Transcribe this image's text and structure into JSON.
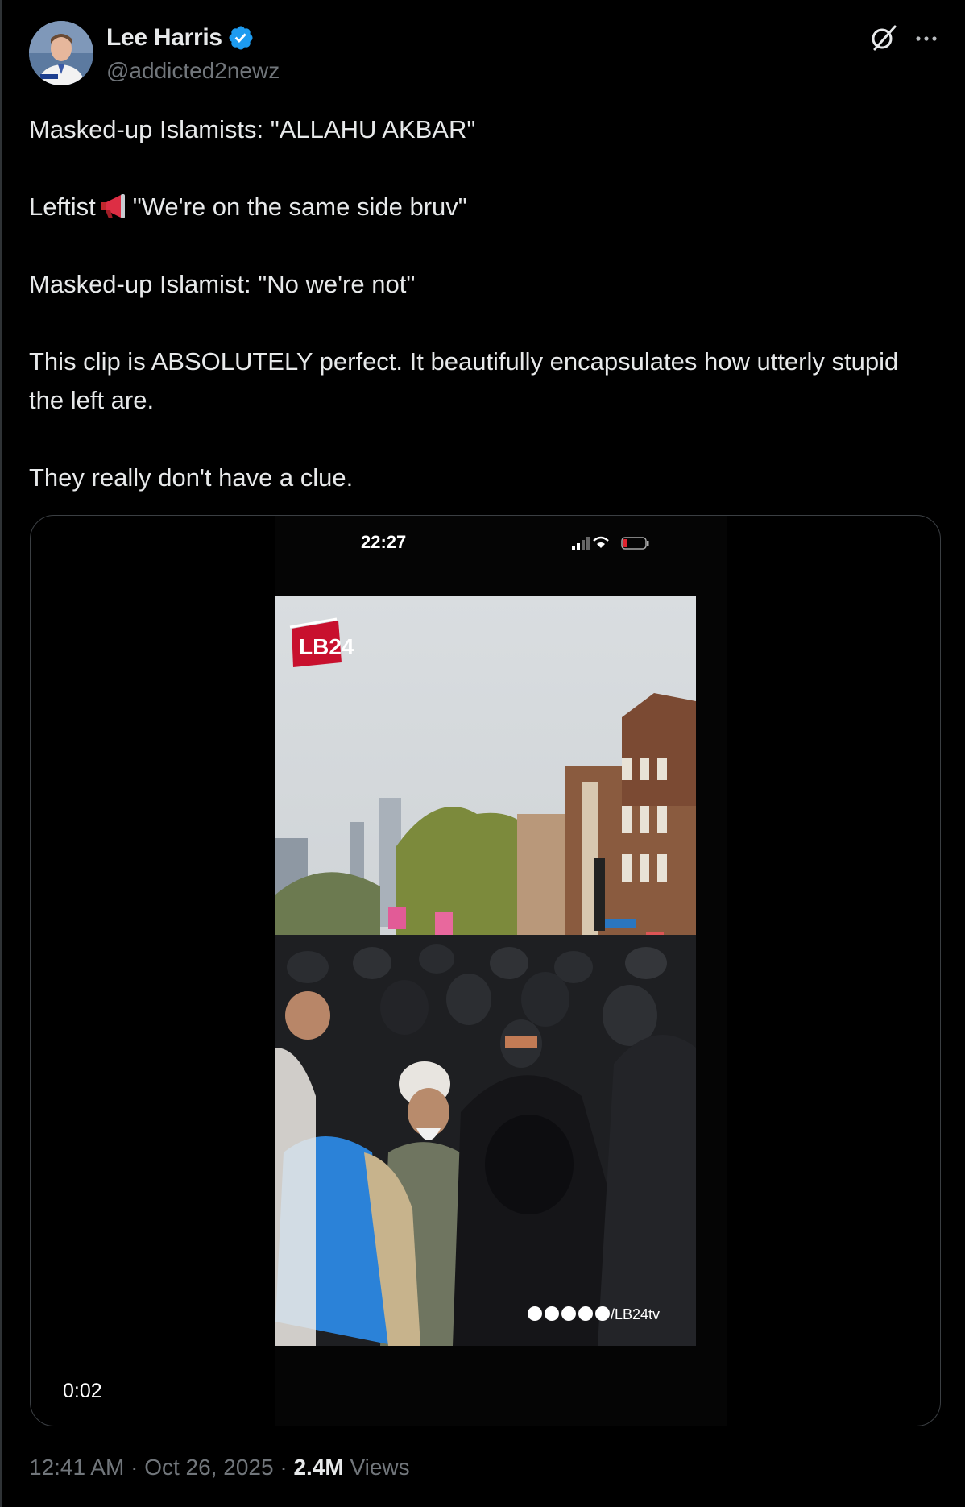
{
  "author": {
    "display_name": "Lee Harris",
    "handle": "@addicted2newz",
    "verified": true
  },
  "icons": {
    "verified": "verified-badge-icon",
    "grok": "grok-icon",
    "more": "more-options-icon",
    "megaphone": "megaphone-emoji"
  },
  "tweet": {
    "line1": "Masked-up Islamists: \"ALLAHU AKBAR\"",
    "line2_before": "Leftist",
    "line2_after": "\"We're on the same side bruv\"",
    "line3": "Masked-up Islamist: \"No we're not\"",
    "line4": "This clip is ABSOLUTELY perfect. It beautifully encapsulates how utterly stupid the left are.",
    "line5": "They really don't have a clue."
  },
  "media": {
    "status_time": "22:27",
    "watermark_logo": "LB24",
    "social_handle": "/LB24tv",
    "duration": "0:02"
  },
  "footer": {
    "time": "12:41 AM",
    "separator": "·",
    "date": "Oct 26, 2025",
    "views_count": "2.4M",
    "views_label": "Views"
  },
  "colors": {
    "background": "#000000",
    "text": "#e7e9ea",
    "secondary": "#71767b",
    "verified": "#1d9bf0",
    "border": "#2f3336"
  }
}
